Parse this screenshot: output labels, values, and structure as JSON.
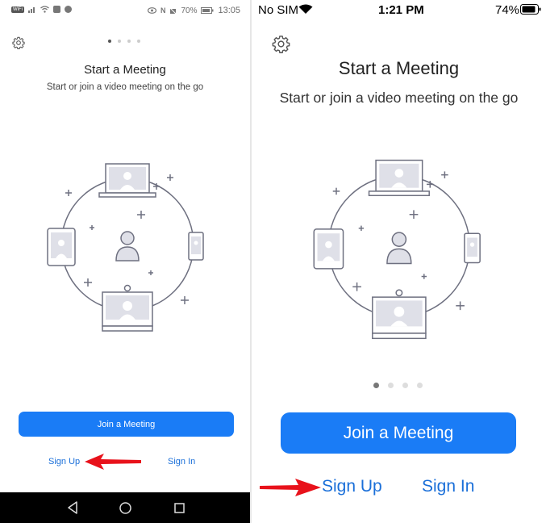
{
  "android": {
    "status": {
      "left_icons": [
        "wifi-badge-icon",
        "signal-icon",
        "wifi-icon",
        "notification-icon",
        "messenger-icon"
      ],
      "battery_percent": "70%",
      "time": "13:05"
    },
    "settings_icon": "gear-icon",
    "page_indicator": {
      "count": 4,
      "active": 0
    },
    "title": "Start a Meeting",
    "subtitle": "Start or join a video meeting on the go",
    "join_button": "Join a Meeting",
    "sign_up": "Sign Up",
    "sign_in": "Sign In",
    "nav": [
      "back-icon",
      "home-icon",
      "recents-icon"
    ]
  },
  "ios": {
    "status": {
      "carrier": "No SIM",
      "time": "1:21 PM",
      "battery_percent": "74%"
    },
    "settings_icon": "gear-icon",
    "title": "Start a Meeting",
    "subtitle": "Start or join a video meeting on the go",
    "page_indicator": {
      "count": 4,
      "active": 0
    },
    "join_button": "Join a Meeting",
    "sign_up": "Sign Up",
    "sign_in": "Sign In"
  },
  "colors": {
    "accent": "#1a7cf6",
    "link": "#1a6fd9",
    "arrow": "#e8121b",
    "illustration": "#6e7080",
    "illustration_fill": "#dfe0e8"
  }
}
